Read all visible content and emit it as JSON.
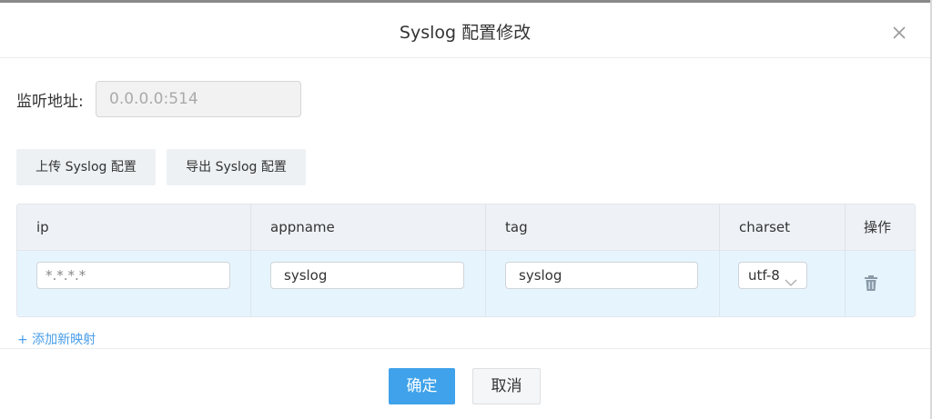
{
  "dialog": {
    "title": "Syslog 配置修改",
    "close_icon": "close-icon"
  },
  "listen": {
    "label": "监听地址:",
    "value": "0.0.0.0:514"
  },
  "toolbar": {
    "upload_label": "上传 Syslog 配置",
    "export_label": "导出 Syslog 配置"
  },
  "table": {
    "columns": [
      "ip",
      "appname",
      "tag",
      "charset",
      "操作"
    ],
    "rows": [
      {
        "ip": "*.*.*.*",
        "appname": "syslog",
        "tag": "syslog",
        "charset": "utf-8",
        "action_icon": "trash-icon"
      }
    ]
  },
  "add_mapping_label": "+ 添加新映射",
  "footer": {
    "ok_label": "确定",
    "cancel_label": "取消"
  },
  "colors": {
    "primary": "#3fa2ea",
    "link": "#4a9ee8",
    "row_highlight": "#e6f4fd"
  }
}
